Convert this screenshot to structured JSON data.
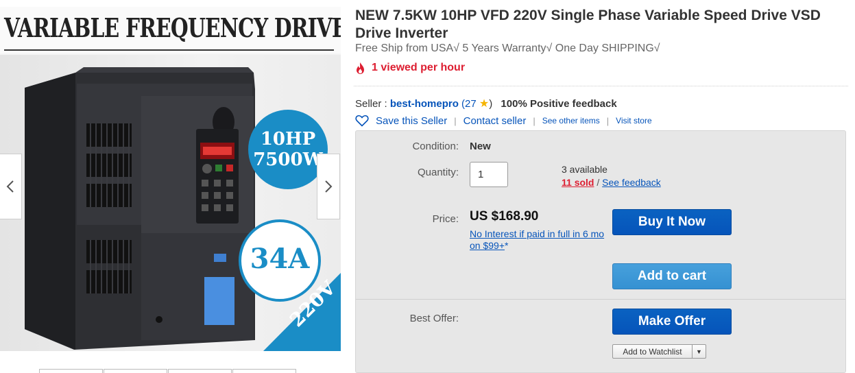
{
  "image_panel": {
    "banner": "VARIABLE FREQUENCY DRIVE",
    "badge_power_1": "10HP",
    "badge_power_2": "7500W",
    "badge_current": "34A",
    "corner_ribbon": "220V",
    "prev_icon": "chevron-left-icon",
    "next_icon": "chevron-right-icon"
  },
  "listing": {
    "title": "NEW 7.5KW 10HP VFD 220V Single Phase Variable Speed Drive VSD Drive Inverter",
    "subtitle": "Free Ship from USA√ 5 Years Warranty√ One Day SHIPPING√",
    "viewed": "1 viewed per hour",
    "viewed_color": "#dd1e31"
  },
  "seller": {
    "prefix": "Seller :",
    "name": "best-homepro",
    "score_open": "(27",
    "score_close": ")",
    "feedback": "100% Positive feedback",
    "save": "Save this Seller",
    "contact": "Contact seller",
    "see_items": "See other items",
    "visit": "Visit store"
  },
  "purchase": {
    "condition_label": "Condition:",
    "condition_value": "New",
    "quantity_label": "Quantity:",
    "quantity_value": "1",
    "available": "3 available",
    "sold": "11 sold",
    "slash": "/",
    "see_feedback": "See feedback",
    "price_label": "Price:",
    "price": "US $168.90",
    "interest_link": "No Interest if paid in full in 6 mo on $99+",
    "interest_star": "*",
    "buy_now": "Buy It Now",
    "add_to_cart": "Add to cart",
    "best_offer_label": "Best Offer:",
    "make_offer": "Make Offer",
    "add_to_watchlist": "Add to Watchlist"
  },
  "colors": {
    "link": "#0654ba",
    "primary_button": "#0654ba",
    "secondary_button": "#3591d2",
    "alert": "#dd1e31"
  }
}
